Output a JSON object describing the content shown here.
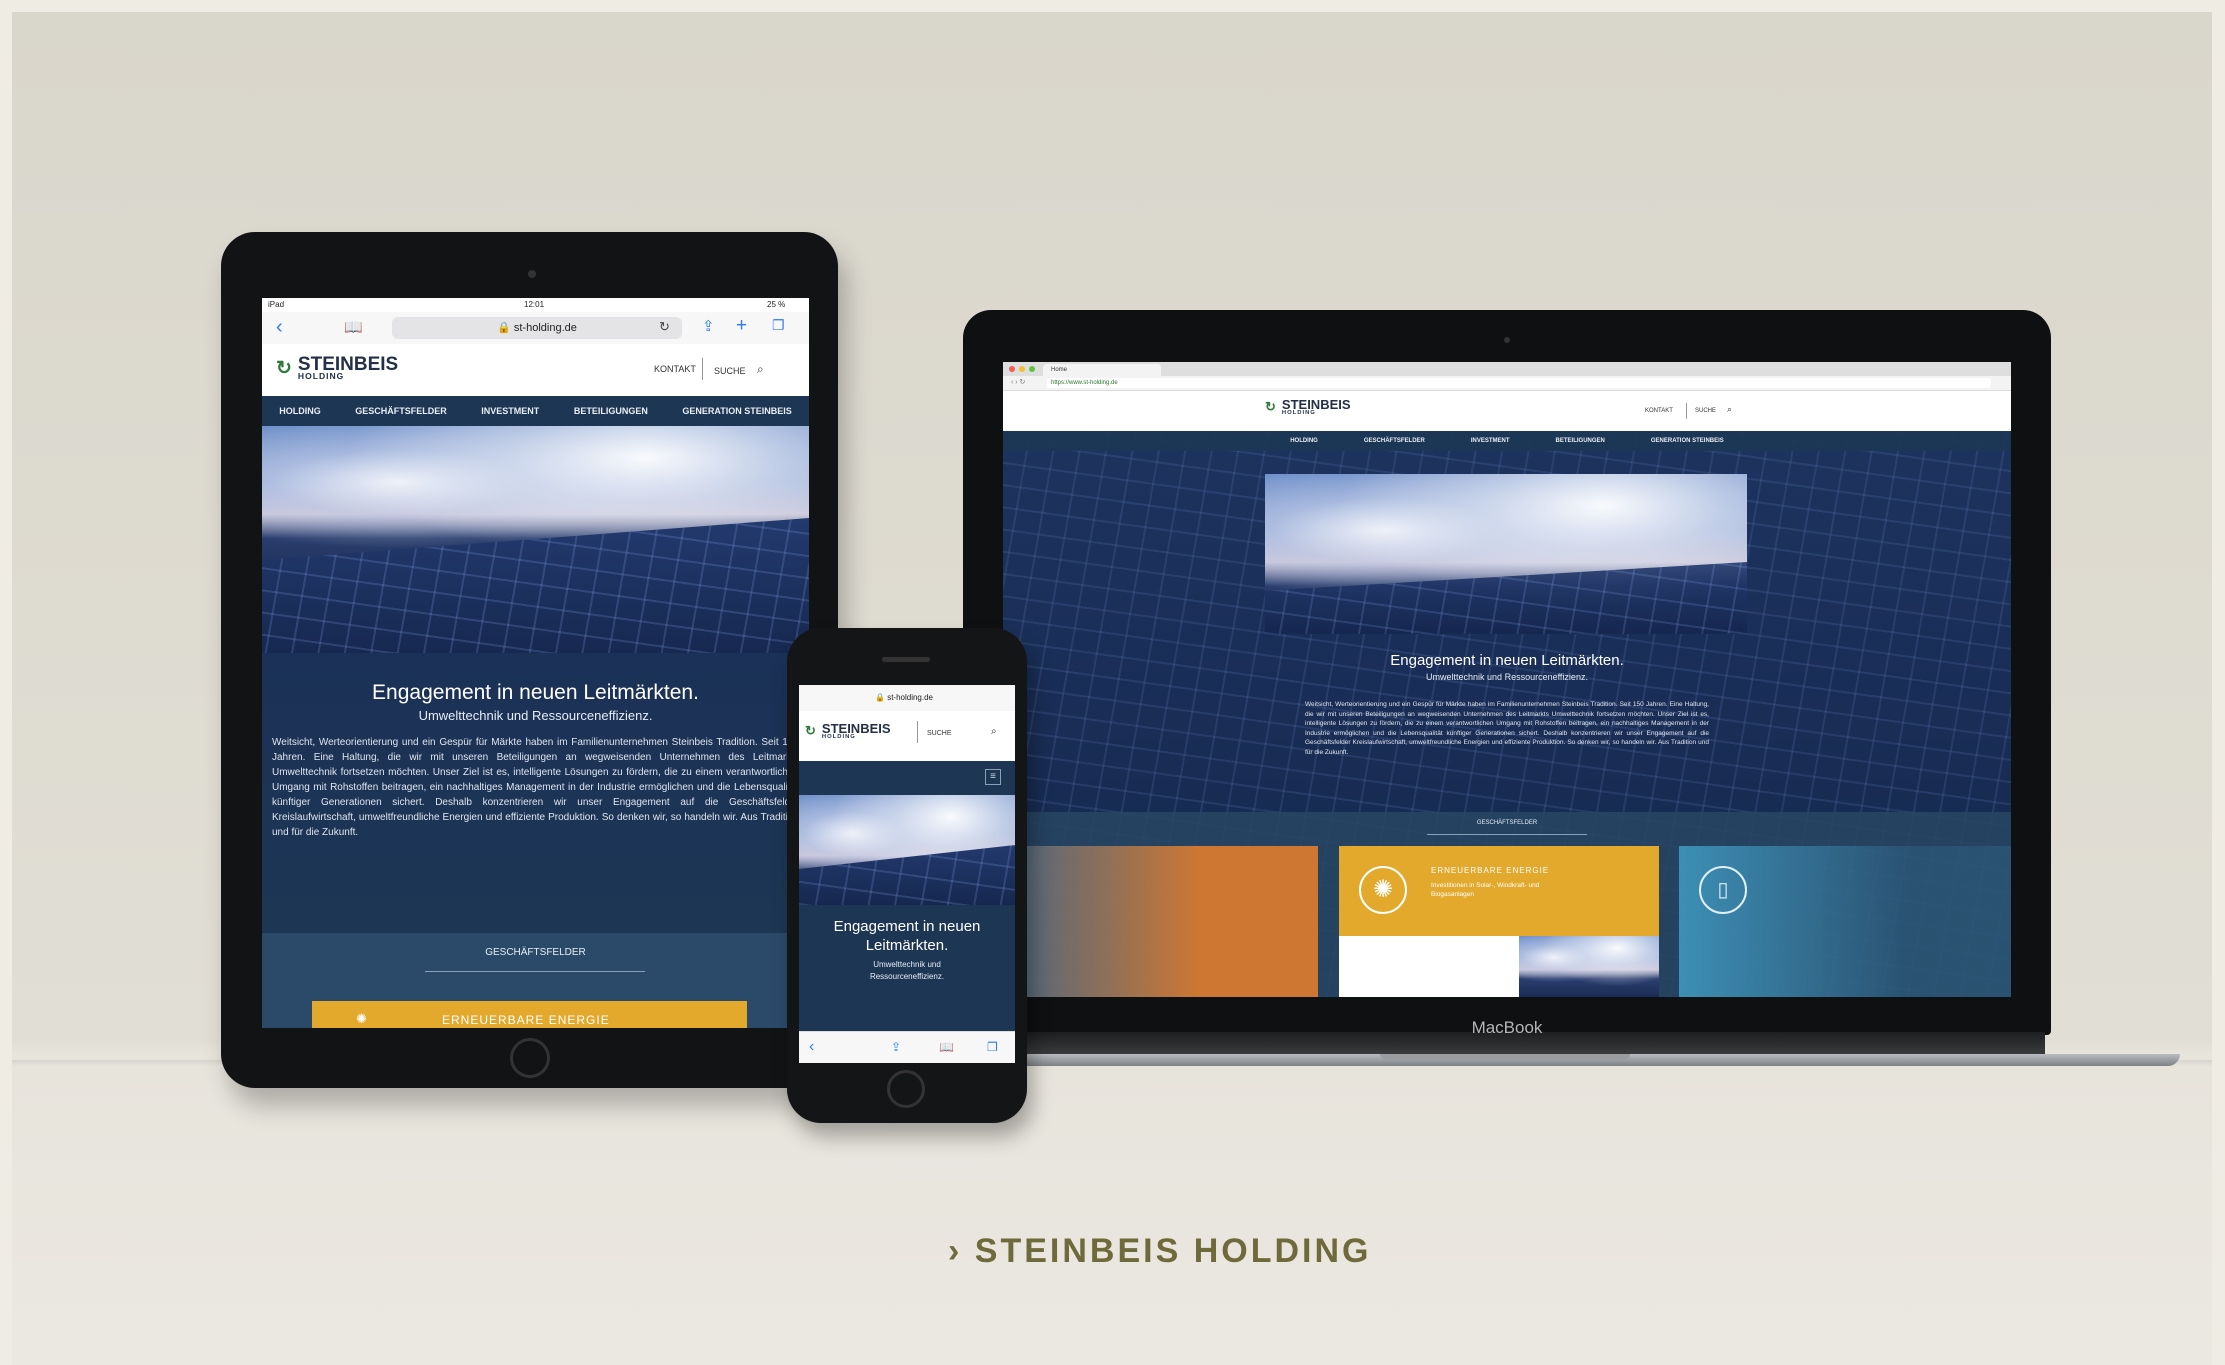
{
  "site": {
    "logo_name": "STEINBEIS",
    "logo_sub": "HOLDING",
    "nav": [
      "HOLDING",
      "GESCHÄFTSFELDER",
      "INVESTMENT",
      "BETEILIGUNGEN",
      "GENERATION STEINBEIS"
    ],
    "kontakt": "KONTAKT",
    "suche": "SUCHE",
    "headline": "Engagement in neuen Leitmärkten.",
    "subline": "Umwelttechnik und Ressourceneffizienz.",
    "intro": "Weitsicht, Werteorientierung und ein Gespür für Märkte haben im Familienunternehmen Steinbeis Tradition. Seit 150 Jahren. Eine Haltung, die wir mit unseren Beteiligungen an wegweisenden Unternehmen des Leitmarkts Umwelttechnik fortsetzen möchten. Unser Ziel ist es, intelligente Lösungen zu fördern, die zu einem verantwortlichen Umgang mit Rohstoffen beitragen, ein nachhaltiges Management in der Industrie ermöglichen und die Lebensqualität künftiger Generationen sichert. Deshalb konzentrieren wir unser Engagement auf die Geschäftsfelder Kreislaufwirtschaft, umweltfreundliche Energien und effiziente Produktion. So denken wir, so handeln wir. Aus Tradition und für die Zukunft.",
    "section_label": "GESCHÄFTSFELDER",
    "card_title": "ERNEUERBARE ENERGIE",
    "card_text": "Investitionen in Solar-, Windkraft- und Biogasanlagen"
  },
  "ipad": {
    "status_left": "iPad",
    "status_time": "12:01",
    "status_right": "25 %",
    "url": "st-holding.de"
  },
  "iphone": {
    "url": "st-holding.de",
    "headline": "Engagement in neuen Leitmärkten.",
    "subline": "Umwelttechnik und Ressourceneffizienz."
  },
  "mac": {
    "tab": "Home",
    "url": "https://www.st-holding.de",
    "label": "MacBook"
  },
  "caption": "› STEINBEIS HOLDING",
  "colors": {
    "navy": "#1d3654",
    "gold": "#e2a92d",
    "orange": "#d77a30",
    "caption": "#6f6a3b",
    "teal": "#3d8fb5"
  }
}
